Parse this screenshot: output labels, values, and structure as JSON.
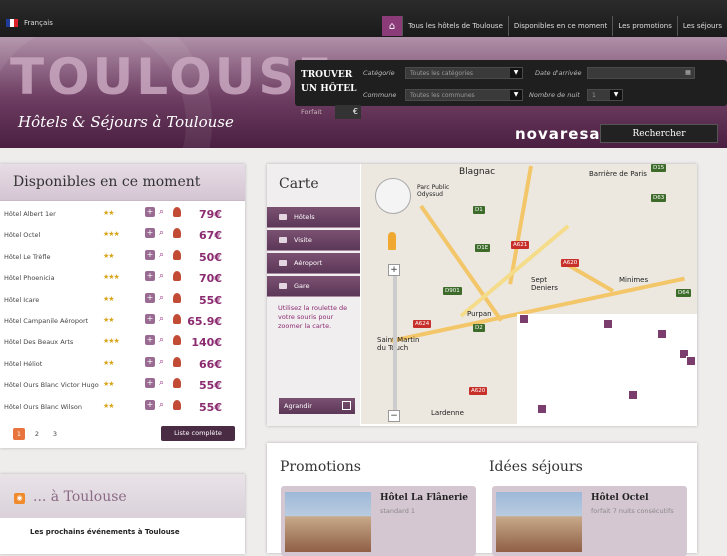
{
  "topbar": {
    "language": "Français",
    "nav": [
      "Tous les hôtels de Toulouse",
      "Disponibles en ce moment",
      "Les promotions",
      "Les séjours"
    ]
  },
  "header": {
    "logo": "TOULOUSE",
    "tagline": "Hôtels & Séjours à Toulouse",
    "search": {
      "title_line1": "TROUVER",
      "title_line2": "UN HÔTEL",
      "categorie_label": "Catégorie",
      "categorie_value": "Toutes les catégories",
      "commune_label": "Commune",
      "commune_value": "Toutes les communes",
      "date_label": "Date d'arrivée",
      "nuits_label": "Nombre de nuit",
      "nuits_value": "1",
      "forfait_label": "Forfait",
      "currency": "€",
      "brand": "novaresa",
      "submit": "Rechercher"
    }
  },
  "dispo": {
    "title": "Disponibles en ce moment",
    "hotels": [
      {
        "name": "Hôtel Albert 1er",
        "stars": "★★",
        "price": "79€"
      },
      {
        "name": "Hôtel Octel",
        "stars": "★★★",
        "price": "67€"
      },
      {
        "name": "Hôtel Le Trèfle",
        "stars": "★★",
        "price": "50€"
      },
      {
        "name": "Hôtel Phoenicia",
        "stars": "★★★",
        "price": "70€"
      },
      {
        "name": "Hôtel Icare",
        "stars": "★★",
        "price": "55€"
      },
      {
        "name": "Hôtel Campanile Aéroport",
        "stars": "★★",
        "price": "65.9€"
      },
      {
        "name": "Hôtel Des Beaux Arts",
        "stars": "★★★",
        "price": "140€"
      },
      {
        "name": "Hôtel Héliot",
        "stars": "★★",
        "price": "66€"
      },
      {
        "name": "Hôtel Ours Blanc Victor Hugo",
        "stars": "★★",
        "price": "55€"
      },
      {
        "name": "Hôtel Ours Blanc Wilson",
        "stars": "★★",
        "price": "55€"
      }
    ],
    "pages": [
      "1",
      "2",
      "3"
    ],
    "list_button": "Liste complète"
  },
  "news": {
    "title": "... à Toulouse",
    "subtitle": "Les prochains événements à Toulouse"
  },
  "carte": {
    "title": "Carte",
    "tabs": [
      "Hôtels",
      "Visite",
      "Aéroport",
      "Gare"
    ],
    "help": "Utilisez la roulette de votre souris pour zoomer la carte.",
    "enlarge": "Agrandir",
    "map_labels": [
      "Blagnac",
      "Barrière de Paris",
      "Minimes",
      "Sept Deniers",
      "Purpan",
      "Saint Martin du Touch",
      "Lardenne",
      "Parc Public Odyssud"
    ],
    "road_labels": [
      "D1",
      "D1E",
      "A621",
      "A620",
      "D901",
      "A624",
      "D2",
      "A620",
      "D15",
      "D64",
      "D63"
    ]
  },
  "promotions": {
    "title": "Promotions",
    "card_title": "Hôtel La Flânerie",
    "card_sub": "standard 1"
  },
  "sejours": {
    "title": "Idées séjours",
    "card_title": "Hôtel Octel",
    "card_sub": "forfait 7 nuits consécutifs"
  },
  "colors": {
    "accent": "#8b3b77",
    "price": "#8b2b70",
    "orange": "#e8733c"
  }
}
